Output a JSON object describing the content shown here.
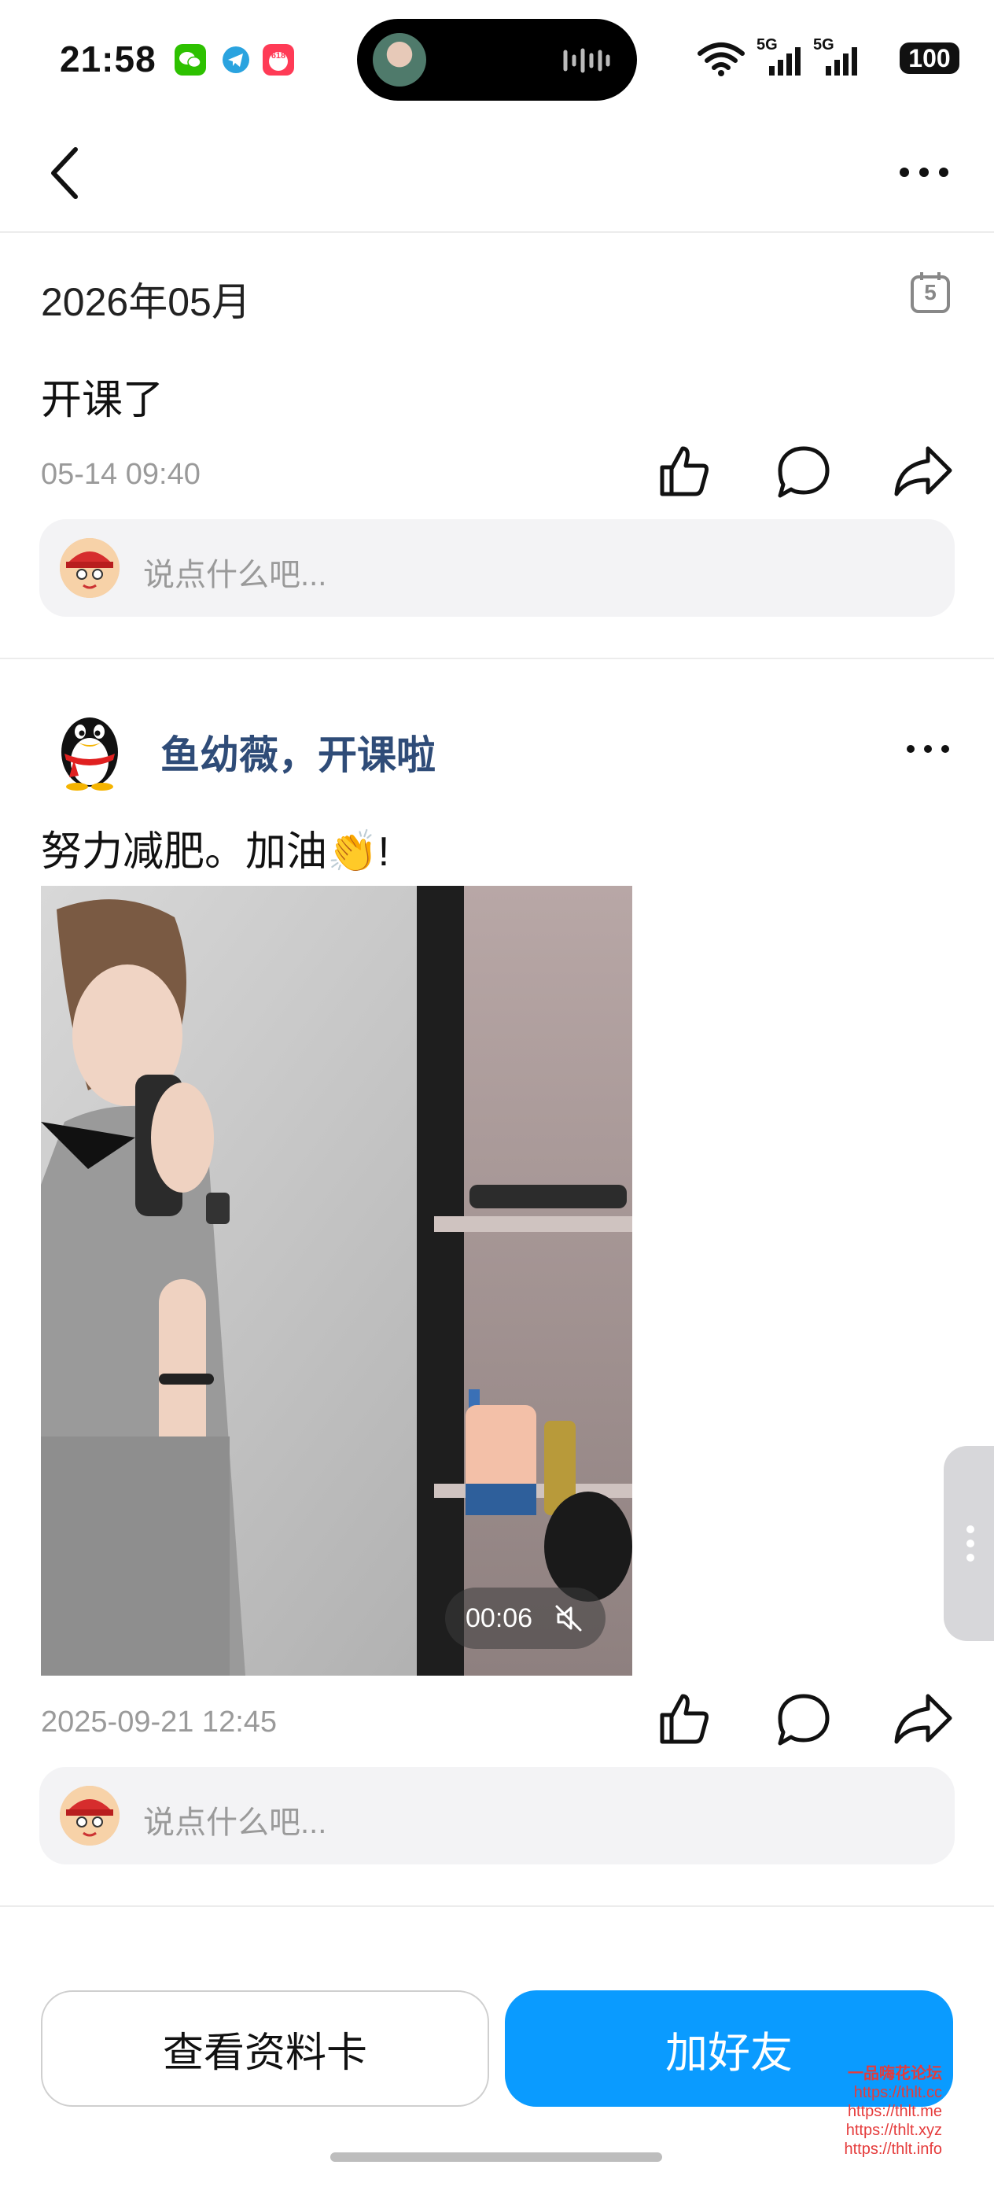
{
  "status_bar": {
    "time": "21:58",
    "network": "5G",
    "battery": "100",
    "app_icons": [
      "wechat-icon",
      "telegram-icon",
      "618-app-icon"
    ]
  },
  "nav": {
    "back_icon": "chevron-left-icon",
    "more_icon": "more-horizontal-icon"
  },
  "section": {
    "date_title": "2026年05月",
    "calendar_day": "5"
  },
  "posts": [
    {
      "text": "开课了",
      "time": "05-14 09:40",
      "comment_placeholder": "说点什么吧..."
    },
    {
      "author": "鱼幼薇，开课啦",
      "text": "努力减肥。加油👏!",
      "video_duration": "00:06",
      "time": "2025-09-21 12:45",
      "comment_placeholder": "说点什么吧..."
    }
  ],
  "actions": {
    "view_profile": "查看资料卡",
    "add_friend": "加好友"
  },
  "watermark": {
    "title": "一品嗨花论坛",
    "links": [
      "https://thlt.cc",
      "https://thlt.me",
      "https://thlt.xyz",
      "https://thlt.info"
    ]
  },
  "colors": {
    "primary": "#0a9bff",
    "author_name": "#2f4c78",
    "meta_gray": "#9a9a9a"
  }
}
